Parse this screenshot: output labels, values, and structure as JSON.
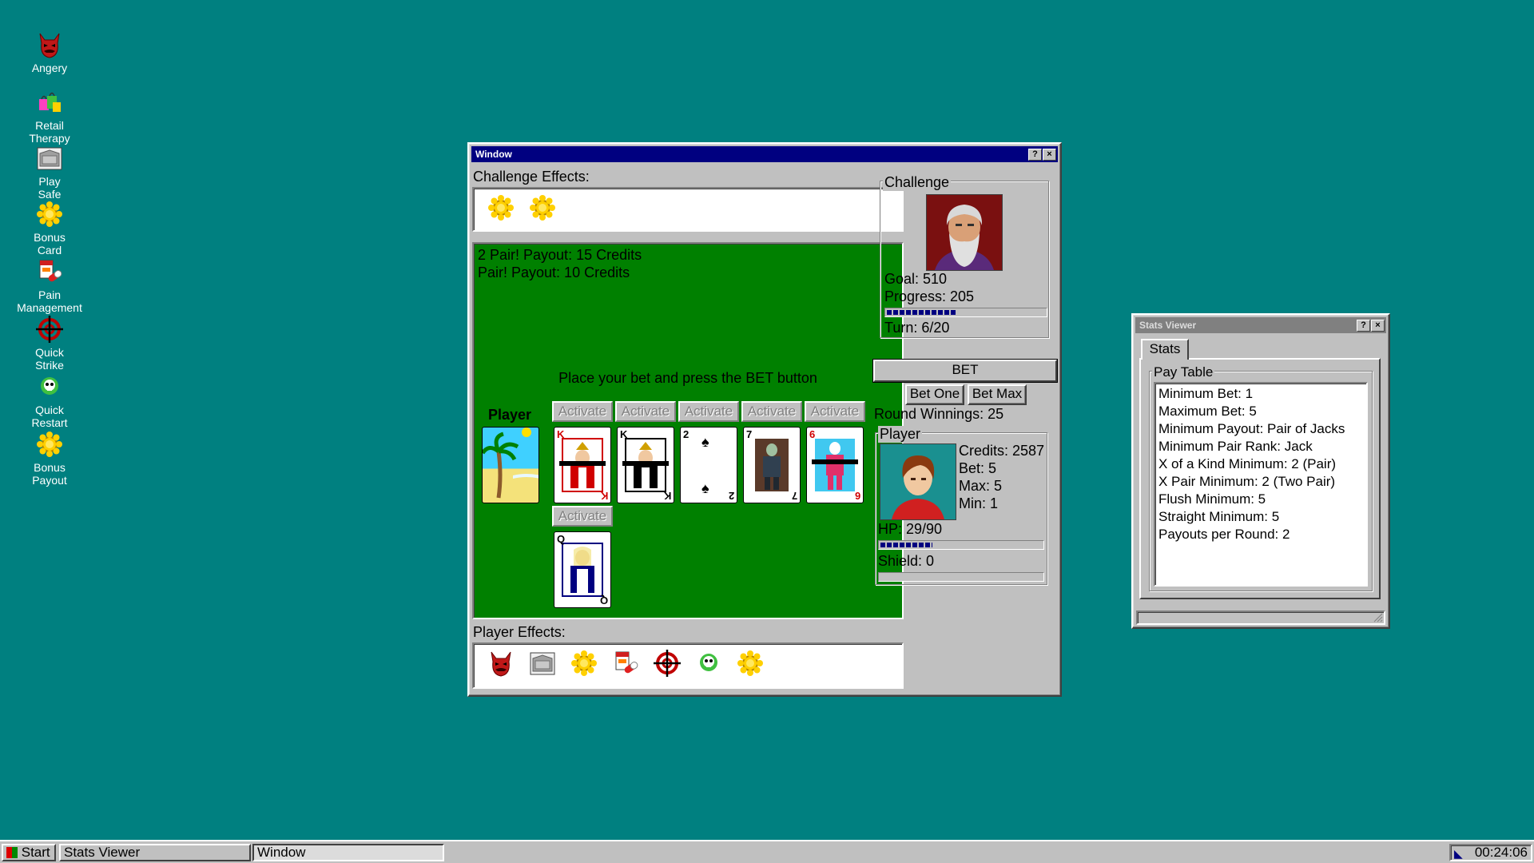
{
  "desktop": {
    "icons": [
      {
        "label": "Angery",
        "icon": "devil-face-icon"
      },
      {
        "label": "Retail\nTherapy",
        "icon": "shopping-bags-icon"
      },
      {
        "label": "Play\nSafe",
        "icon": "safe-icon"
      },
      {
        "label": "Bonus\nCard",
        "icon": "gold-coin-icon"
      },
      {
        "label": "Pain\nManagement",
        "icon": "pills-icon"
      },
      {
        "label": "Quick\nStrike",
        "icon": "crosshair-icon"
      },
      {
        "label": "Quick\nRestart",
        "icon": "skull-icon"
      },
      {
        "label": "Bonus\nPayout",
        "icon": "gold-coin-icon"
      }
    ]
  },
  "main_window": {
    "title": "Window",
    "help_btn": "?",
    "close_btn": "×",
    "challenge_effects_label": "Challenge Effects:",
    "challenge_effects": [
      "gold-coin-icon",
      "gold-coin-icon"
    ],
    "log": [
      "2 Pair! Payout: 15 Credits",
      "Pair! Payout: 10 Credits"
    ],
    "prompt": "Place your bet and press the BET button",
    "player_label": "Player",
    "activate_label": "Activate",
    "cards": [
      {
        "rank": "K",
        "suit": "♦",
        "color": "red",
        "figure": "king"
      },
      {
        "rank": "K",
        "suit": "♣",
        "color": "black",
        "figure": "king"
      },
      {
        "rank": "2",
        "suit": "♠",
        "color": "black",
        "figure": "pip"
      },
      {
        "rank": "7",
        "suit": "♣",
        "color": "black",
        "figure": "zombie"
      },
      {
        "rank": "6",
        "suit": "♦",
        "color": "red",
        "figure": "clown"
      }
    ],
    "extra_card": {
      "rank": "Q",
      "suit": "♣",
      "color": "black",
      "figure": "queen"
    },
    "player_effects_label": "Player Effects:",
    "player_effects": [
      "devil-face-icon",
      "safe-icon",
      "gold-coin-icon",
      "pills-icon",
      "crosshair-icon",
      "skull-icon",
      "gold-coin-icon"
    ],
    "challenge": {
      "group_label": "Challenge",
      "goal": "Goal: 510",
      "progress": "Progress: 205",
      "progress_fraction": 0.44,
      "turn": "Turn: 6/20"
    },
    "bet_button": "BET",
    "bet_one_button": "Bet One",
    "bet_max_button": "Bet Max",
    "round_winnings": "Round Winnings: 25",
    "player": {
      "group_label": "Player",
      "credits": "Credits: 2587",
      "bet": "Bet: 5",
      "max": "Max: 5",
      "min": "Min: 1",
      "hp": "HP: 29/90",
      "hp_fraction": 0.32,
      "shield": "Shield: 0",
      "shield_fraction": 0
    }
  },
  "stats_window": {
    "title": "Stats Viewer",
    "help_btn": "?",
    "close_btn": "×",
    "tab": "Stats",
    "group_label": "Pay Table",
    "items": [
      "Minimum Bet: 1",
      "Maximum Bet: 5",
      "Minimum Payout: Pair of Jacks",
      "Minimum Pair Rank: Jack",
      "X of a Kind Minimum: 2 (Pair)",
      "X Pair Minimum: 2 (Two Pair)",
      "Flush Minimum: 5",
      "Straight Minimum: 5",
      "Payouts per Round: 2"
    ]
  },
  "taskbar": {
    "start": "Start",
    "tasks": [
      "Stats Viewer",
      "Window"
    ],
    "clock": "00:24:06"
  }
}
